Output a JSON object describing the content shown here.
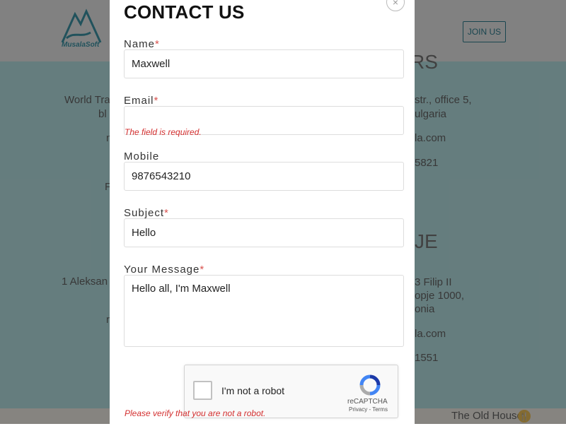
{
  "background": {
    "logo_text": "MusalaSoft",
    "join_button": "JOIN US",
    "texts": [
      {
        "text": "World Tra",
        "cls": "bgt",
        "id": "bg-text-1"
      },
      {
        "text": "bl",
        "cls": "bgt",
        "id": "bg-text-2"
      },
      {
        "text": "n",
        "cls": "bgt",
        "id": "bg-text-3"
      },
      {
        "text": "F",
        "cls": "bgt",
        "id": "bg-text-4"
      },
      {
        "text": "1 Aleksan",
        "cls": "bgt",
        "id": "bg-text-5"
      },
      {
        "text": "r",
        "cls": "bgt",
        "id": "bg-text-6"
      },
      {
        "text": "RS",
        "cls": "bgt big",
        "id": "bg-text-7"
      },
      {
        "text": "str., office 5,",
        "cls": "bgt",
        "id": "bg-text-8"
      },
      {
        "text": "ulgaria",
        "cls": "bgt",
        "id": "bg-text-9"
      },
      {
        "text": "la.com",
        "cls": "bgt",
        "id": "bg-text-10"
      },
      {
        "text": "5821",
        "cls": "bgt",
        "id": "bg-text-11"
      },
      {
        "text": "JE",
        "cls": "bgt big",
        "id": "bg-text-12"
      },
      {
        "text": "3 Filip II",
        "cls": "bgt",
        "id": "bg-text-13"
      },
      {
        "text": "opje 1000,",
        "cls": "bgt",
        "id": "bg-text-14"
      },
      {
        "text": "onia",
        "cls": "bgt",
        "id": "bg-text-15"
      },
      {
        "text": "la.com",
        "cls": "bgt",
        "id": "bg-text-16"
      },
      {
        "text": "1551",
        "cls": "bgt",
        "id": "bg-text-17"
      },
      {
        "text": "The Old House",
        "cls": "bgt",
        "id": "bg-text-18"
      }
    ]
  },
  "modal": {
    "title": "CONTACT US",
    "close_icon": "×",
    "fields": {
      "name": {
        "label": "Name",
        "required": "*",
        "value": "Maxwell"
      },
      "email": {
        "label": "Email",
        "required": "*",
        "value": "",
        "error": "The field is required."
      },
      "mobile": {
        "label": "Mobile",
        "value": "9876543210"
      },
      "subject": {
        "label": "Subject",
        "required": "*",
        "value": "Hello"
      },
      "message": {
        "label": "Your Message",
        "required": "*",
        "value": "Hello all, I'm Maxwell"
      }
    },
    "recaptcha": {
      "label": "I'm not a robot",
      "brand": "reCAPTCHA",
      "links": "Privacy - Terms",
      "error": "Please verify that you are not a robot."
    }
  },
  "colors": {
    "accent": "#2e7f91",
    "error": "#d32f2f",
    "background_teal": "#b9e3e5"
  }
}
